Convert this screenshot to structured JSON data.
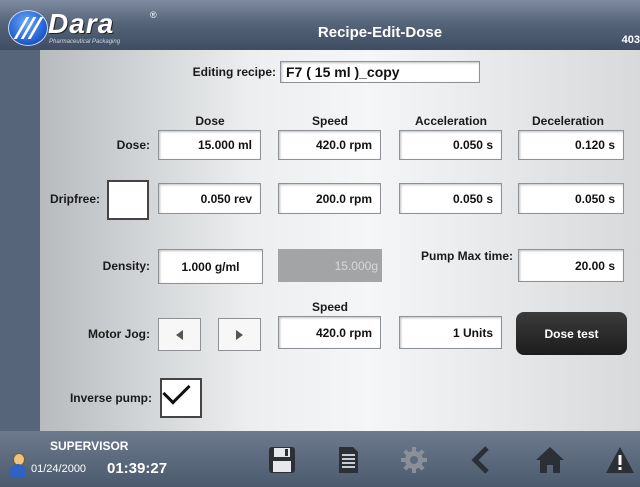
{
  "header": {
    "logo_text": "Dara",
    "logo_reg": "®",
    "logo_sub": "Pharmaceutical Packaging",
    "title": "Recipe-Edit-Dose",
    "screen_number": "403"
  },
  "recipe": {
    "label": "Editing recipe:",
    "name": "F7 ( 15 ml )_copy"
  },
  "columns": {
    "dose": "Dose",
    "speed": "Speed",
    "acceleration": "Acceleration",
    "deceleration": "Deceleration"
  },
  "dose_row": {
    "label": "Dose:",
    "dose": "15.000  ml",
    "speed": "420.0 rpm",
    "acceleration": "0.050 s",
    "deceleration": "0.120 s"
  },
  "dripfree_row": {
    "label": "Dripfree:",
    "checked": false,
    "dose": "0.050 rev",
    "speed": "200.0 rpm",
    "acceleration": "0.050 s",
    "deceleration": "0.050 s"
  },
  "density": {
    "label": "Density:",
    "value": "1.000 g/ml",
    "computed": "15.000g"
  },
  "pump_max_time": {
    "label": "Pump Max time:",
    "value": "20.00 s"
  },
  "motor_jog": {
    "speed_header": "Speed",
    "label": "Motor Jog:",
    "speed": "420.0 rpm",
    "units": "1 Units",
    "dose_test_button": "Dose test"
  },
  "inverse_pump": {
    "label": "Inverse pump:",
    "checked": true
  },
  "footer": {
    "role": "SUPERVISOR",
    "date": "01/24/2000",
    "time": "01:39:27"
  },
  "colors": {
    "header_bg": "#56657a",
    "dark_button": "#1c1c1c",
    "warning_triangle": "#ffffff"
  }
}
